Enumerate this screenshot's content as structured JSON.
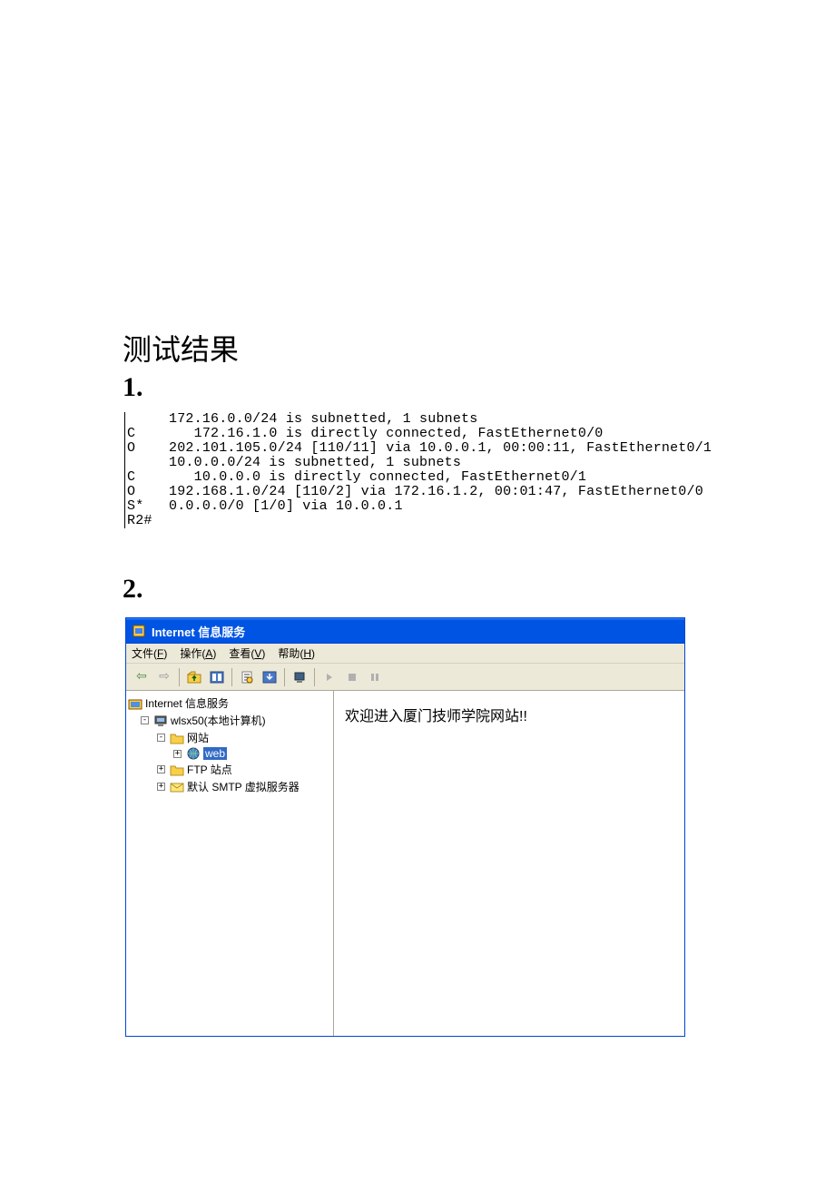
{
  "doc": {
    "title": "测试结果",
    "section1": "1.",
    "section2": "2."
  },
  "terminal": {
    "line1": "     172.16.0.0/24 is subnetted, 1 subnets",
    "line2": "C       172.16.1.0 is directly connected, FastEthernet0/0",
    "line3": "O    202.101.105.0/24 [110/11] via 10.0.0.1, 00:00:11, FastEthernet0/1",
    "line4": "     10.0.0.0/24 is subnetted, 1 subnets",
    "line5": "C       10.0.0.0 is directly connected, FastEthernet0/1",
    "line6": "O    192.168.1.0/24 [110/2] via 172.16.1.2, 00:01:47, FastEthernet0/0",
    "line7": "S*   0.0.0.0/0 [1/0] via 10.0.0.1",
    "line8": "R2#"
  },
  "iis": {
    "title": "Internet 信息服务",
    "menu": {
      "file": "文件(F)",
      "action": "操作(A)",
      "view": "查看(V)",
      "help": "帮助(H)"
    },
    "tree": {
      "root": "Internet 信息服务",
      "computer": "wlsx50(本地计算机)",
      "websites": "网站",
      "web": "web",
      "ftp": "FTP 站点",
      "smtp": "默认 SMTP 虚拟服务器"
    },
    "content": "欢迎进入厦门技师学院网站!!"
  }
}
